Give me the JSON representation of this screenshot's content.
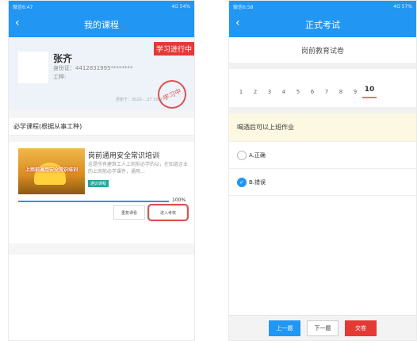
{
  "phone1": {
    "status_left": "微信6:47",
    "status_right": "4G 54%",
    "title": "我的课程",
    "back_glyph": "‹",
    "profile": {
      "name": "张齐",
      "id_label": "身份证：",
      "id_value": "4412831995********",
      "type_label": "工种:",
      "banner": "学习进行中",
      "stamp": "学习中",
      "date": "更新于：2020-...27 10:47"
    },
    "section_title": "必学课程(根据从事工种)",
    "course": {
      "thumb_text": "上岗前通用安全常识培训",
      "title": "岗前通用安全常识培训",
      "desc": "这是所有建筑工人上岗前必学的以，在知道企业的上岗前必学课件，通用…",
      "tag": "通识课程",
      "progress_value": 100,
      "progress_text": "100%",
      "retake_label": "重复课看",
      "enter_exam_label": "进入考核"
    }
  },
  "phone2": {
    "status_left": "微信6:58",
    "status_right": "4G 57%",
    "title": "正式考试",
    "back_glyph": "‹",
    "subtitle": "岗前教育试卷",
    "question_numbers": [
      "1",
      "2",
      "3",
      "4",
      "5",
      "6",
      "7",
      "8",
      "9",
      "10"
    ],
    "active_question": "10",
    "question": "喝酒后可以上班作业",
    "options": [
      {
        "label": "A.正确",
        "checked": false
      },
      {
        "label": "B.错误",
        "checked": true
      }
    ],
    "footer": {
      "prev": "上一题",
      "next": "下一题",
      "submit": "交卷"
    }
  }
}
